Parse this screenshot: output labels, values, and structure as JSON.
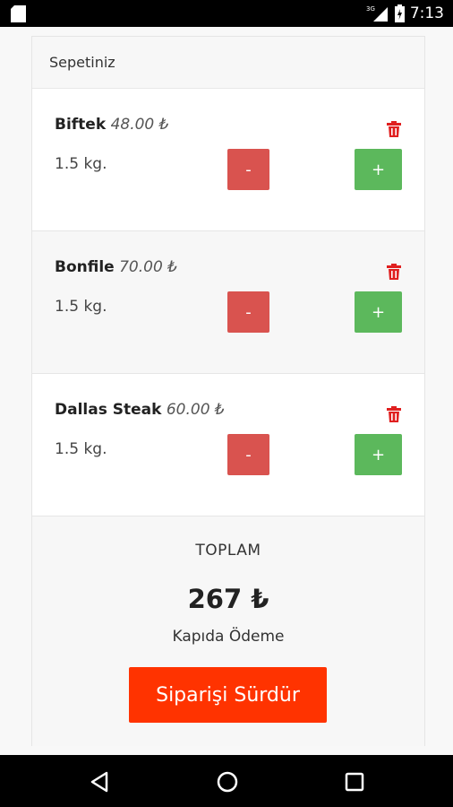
{
  "status_bar": {
    "network": "3G",
    "time": "7:13"
  },
  "cart": {
    "title": "Sepetiniz",
    "items": [
      {
        "name": "Biftek",
        "price": "48.00 ₺",
        "quantity": "1.5 kg.",
        "minus_label": "-",
        "plus_label": "+"
      },
      {
        "name": "Bonfile",
        "price": "70.00 ₺",
        "quantity": "1.5 kg.",
        "minus_label": "-",
        "plus_label": "+"
      },
      {
        "name": "Dallas Steak",
        "price": "60.00 ₺",
        "quantity": "1.5 kg.",
        "minus_label": "-",
        "plus_label": "+"
      }
    ]
  },
  "summary": {
    "label": "TOPLAM",
    "amount": "267 ₺",
    "payment_method": "Kapıda Ödeme",
    "continue_label": "Siparişi Sürdür"
  },
  "colors": {
    "minus": "#d9534f",
    "plus": "#5cb85c",
    "cta": "#ff3300",
    "trash": "#e02020"
  }
}
